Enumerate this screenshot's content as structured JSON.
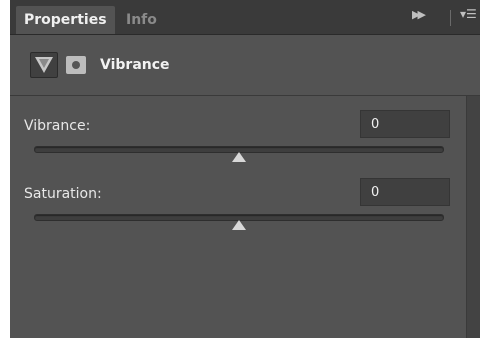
{
  "tabs": {
    "active": "Properties",
    "inactive": "Info"
  },
  "toolbar": {
    "expand_icon": "double-chevron-right-icon",
    "menu_icon": "panel-menu-icon"
  },
  "header": {
    "adjustment_icon": "vibrance-adjustment-icon",
    "mask_icon": "layer-mask-icon",
    "title": "Vibrance"
  },
  "controls": [
    {
      "label": "Vibrance:",
      "value": "0",
      "slider_position": 0.5
    },
    {
      "label": "Saturation:",
      "value": "0",
      "slider_position": 0.5
    }
  ],
  "colors": {
    "panel_bg": "#535353",
    "tabbar_bg": "#3a3a3a",
    "field_bg": "#404040",
    "text": "#e8e8e8"
  }
}
